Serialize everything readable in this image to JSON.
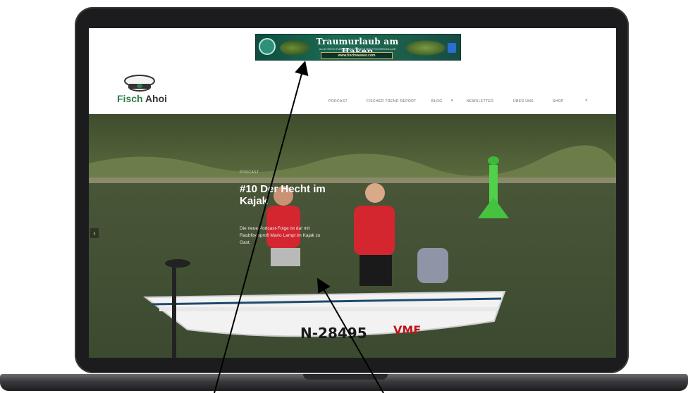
{
  "ad": {
    "title": "Traumurlaub am Haken",
    "subtitle": "ALLE INFOS FÜR DEINEN PERFEKTEN FISCHERURLAUB",
    "url": "www.fischwasser.com"
  },
  "site": {
    "logo_text_1": "Fisch",
    "logo_text_2": " Ahoi"
  },
  "nav": {
    "items": [
      "PODCAST",
      "FISCHER TREND REPORT",
      "BLOG",
      "NEWSLETTER",
      "ÜBER UNS",
      "SHOP"
    ]
  },
  "hero": {
    "category": "PODCAST",
    "title": "#10 Der Hecht im Kajak",
    "text": "Die neue Podcast-Folge ist da! mit Raubfischprofi Mario Lampl im Kajak zu Gast.",
    "arrow": "‹",
    "boat_number": "N-28495",
    "boat_brand": "VMF"
  },
  "colors": {
    "accent_green": "#2f7d4a",
    "laptop_frame": "#1c1c1e"
  }
}
